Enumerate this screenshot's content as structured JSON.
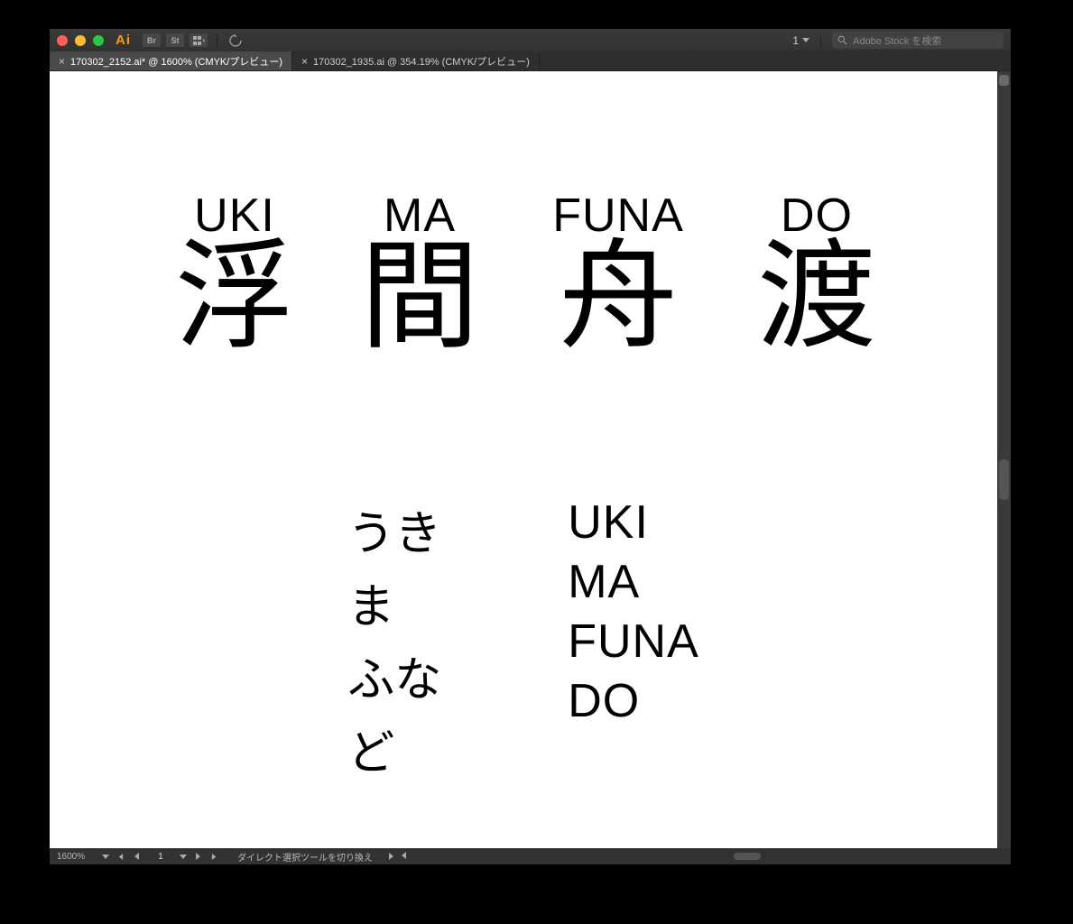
{
  "app": {
    "name": "Ai"
  },
  "toolbar_icons": {
    "br": "Br",
    "st": "St"
  },
  "artboard_selector": "1",
  "search": {
    "placeholder": "Adobe Stock を検索"
  },
  "tabs": [
    {
      "label": "170302_2152.ai* @ 1600% (CMYK/プレビュー)",
      "active": true
    },
    {
      "label": "170302_1935.ai @ 354.19% (CMYK/プレビュー)",
      "active": false
    }
  ],
  "artwork": {
    "top": [
      {
        "romaji": "UKI",
        "kanji": "浮"
      },
      {
        "romaji": "MA",
        "kanji": "間"
      },
      {
        "romaji": "FUNA",
        "kanji": "舟"
      },
      {
        "romaji": "DO",
        "kanji": "渡"
      }
    ],
    "hira": [
      "うき",
      "ま",
      "ふな",
      "ど"
    ],
    "rom": [
      "UKI",
      "MA",
      "FUNA",
      "DO"
    ]
  },
  "status": {
    "zoom": "1600%",
    "artboard_current": "1",
    "tool_message": "ダイレクト選択ツールを切り換え"
  }
}
